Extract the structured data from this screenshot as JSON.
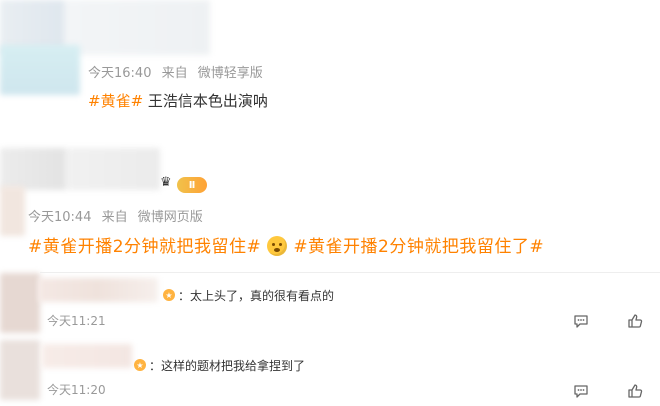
{
  "post1": {
    "time": "今天16:40",
    "source_prefix": "来自",
    "source": "微博轻享版",
    "topic": "#黄雀#",
    "text": " 王浩信本色出演呐"
  },
  "post2": {
    "time": "今天10:44",
    "source_prefix": "来自",
    "source": "微博网页版",
    "topic1": "#黄雀开播2分钟就把我留住#",
    "topic2": "#黄雀开播2分钟就把我留住了#",
    "badge": "Ⅱ"
  },
  "comments": [
    {
      "text": "：太上头了，真的很有看点的",
      "time": "今天11:21"
    },
    {
      "text": "：这样的题材把我给拿捏到了",
      "time": "今天11:20"
    }
  ],
  "colors": {
    "topic": "#ff8200",
    "meta": "#999999"
  },
  "icons": [
    "comment-icon",
    "like-icon",
    "emoji-face-icon",
    "crown-icon",
    "user-avatar-icon"
  ]
}
